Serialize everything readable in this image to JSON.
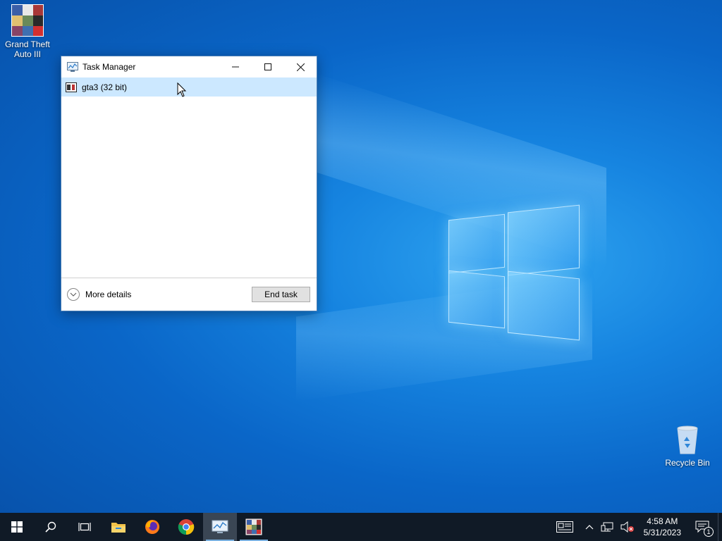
{
  "desktop": {
    "icons": [
      {
        "label": "Grand Theft Auto III",
        "icon": "gta3-game-icon"
      },
      {
        "label": "Recycle Bin",
        "icon": "recycle-bin-icon"
      }
    ]
  },
  "task_manager": {
    "title": "Task Manager",
    "window_controls": {
      "minimize": "minimize-icon",
      "maximize": "maximize-icon",
      "close": "close-icon"
    },
    "processes": [
      {
        "label": "gta3 (32 bit)",
        "icon": "gta3-app-icon",
        "selected": true
      }
    ],
    "more_details_label": "More details",
    "end_task_label": "End task"
  },
  "taskbar": {
    "buttons": [
      {
        "name": "start",
        "icon": "windows-start-icon"
      },
      {
        "name": "search",
        "icon": "search-icon"
      },
      {
        "name": "task-view",
        "icon": "task-view-icon"
      },
      {
        "name": "file-explorer",
        "icon": "folder-icon"
      },
      {
        "name": "firefox",
        "icon": "firefox-icon"
      },
      {
        "name": "chrome",
        "icon": "chrome-icon"
      },
      {
        "name": "task-manager",
        "icon": "task-manager-icon",
        "active": true
      },
      {
        "name": "gta3",
        "icon": "gta3-icon",
        "running": true
      }
    ],
    "tray": {
      "clock_time": "4:58 AM",
      "clock_date": "5/31/2023",
      "notification_count": "1"
    }
  },
  "colors": {
    "selection": "#cce8ff",
    "taskbar": "#101a26",
    "window_border": "#4a7eb6"
  }
}
